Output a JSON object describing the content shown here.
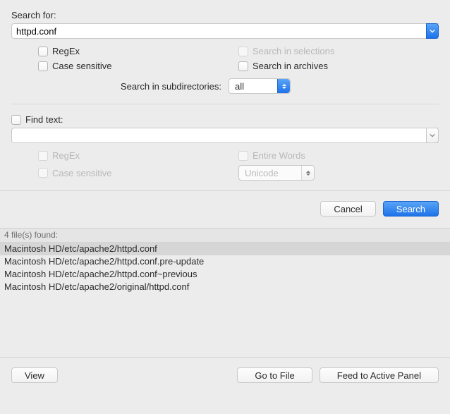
{
  "search": {
    "searchFor_label": "Search for:",
    "searchFor_value": "httpd.conf",
    "regex_label": "RegEx",
    "case_label": "Case sensitive",
    "selections_label": "Search in selections",
    "archives_label": "Search in archives",
    "subdirs_label": "Search in subdirectories:",
    "subdirs_value": "all"
  },
  "findtext": {
    "toggle_label": "Find text:",
    "value": "",
    "regex_label": "RegEx",
    "case_label": "Case sensitive",
    "entire_label": "Entire Words",
    "encoding_value": "Unicode"
  },
  "buttons": {
    "cancel": "Cancel",
    "search": "Search",
    "view": "View",
    "goto": "Go to File",
    "feed": "Feed to Active Panel"
  },
  "results": {
    "header": "4 file(s) found:",
    "items": [
      "Macintosh HD/etc/apache2/httpd.conf",
      "Macintosh HD/etc/apache2/httpd.conf.pre-update",
      "Macintosh HD/etc/apache2/httpd.conf~previous",
      "Macintosh HD/etc/apache2/original/httpd.conf"
    ],
    "selected_index": 0
  }
}
